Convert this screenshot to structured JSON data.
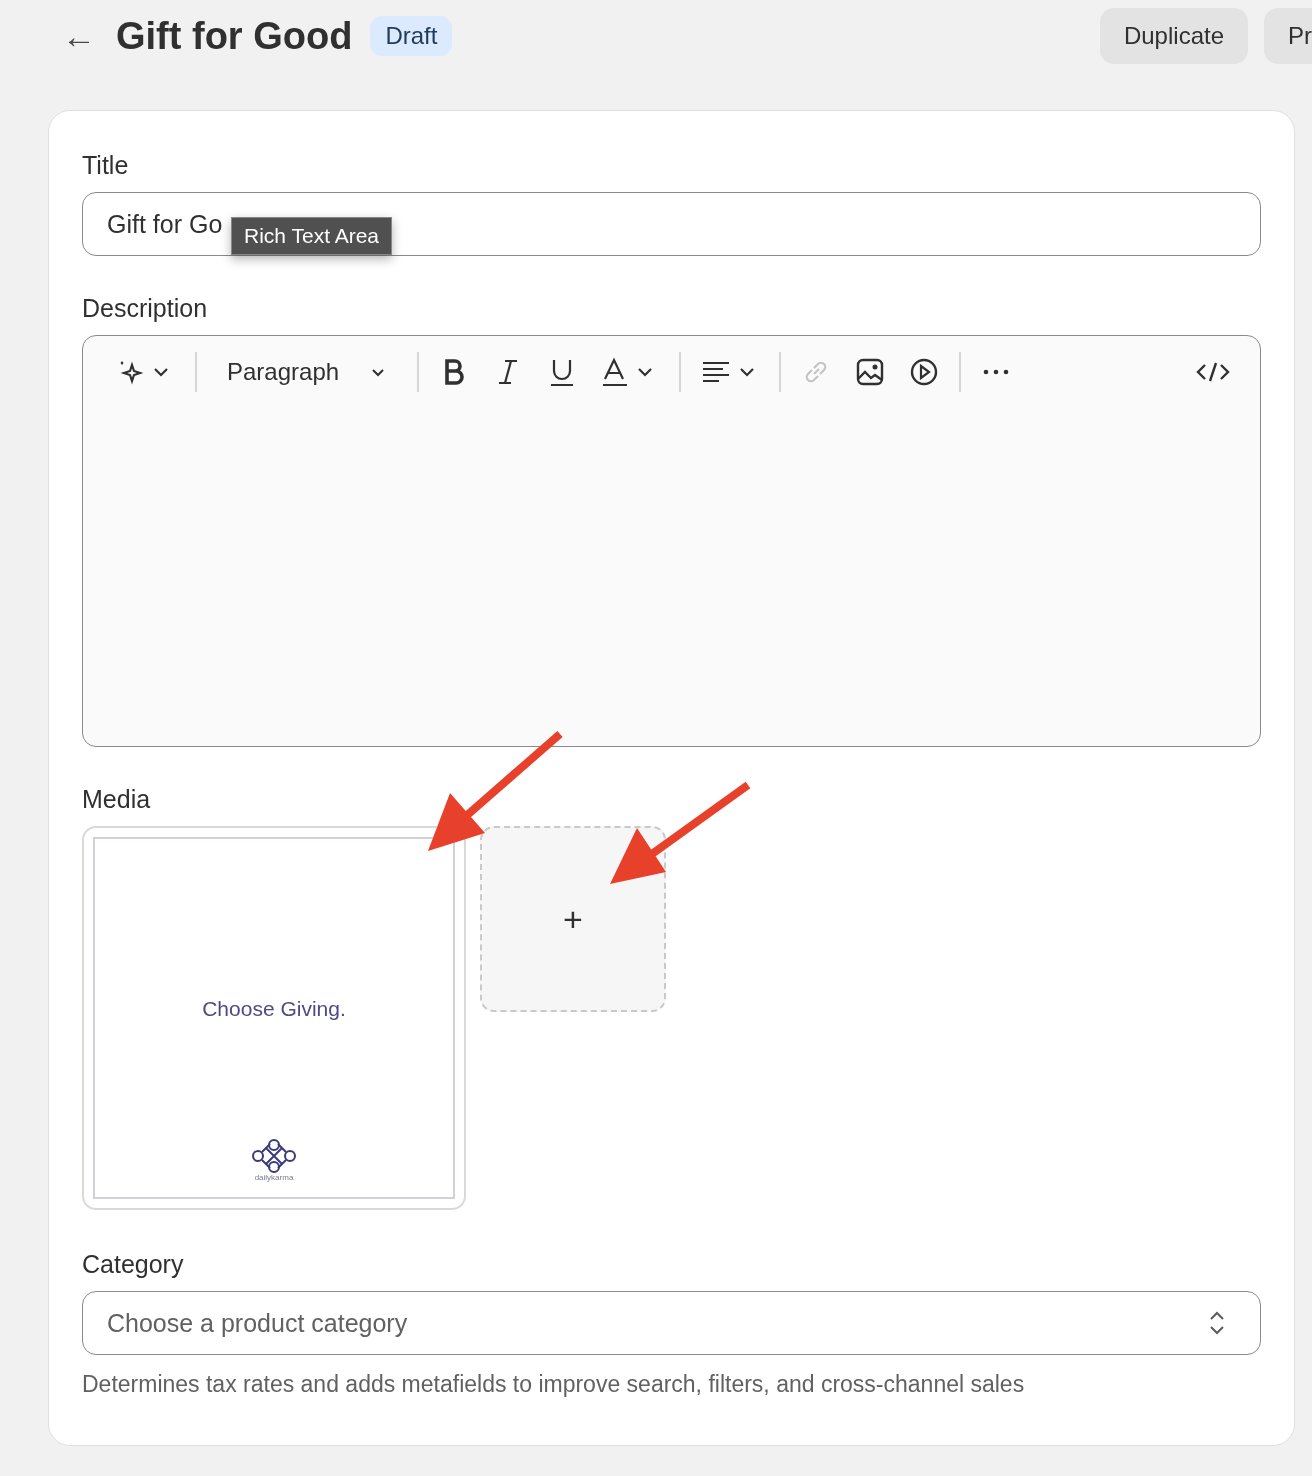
{
  "header": {
    "back": "←",
    "title": "Gift for Good",
    "status": "Draft",
    "buttons": [
      "Duplicate",
      "Pr"
    ]
  },
  "title_field": {
    "label": "Title",
    "value": "Gift for Go",
    "tooltip": "Rich Text Area"
  },
  "description": {
    "label": "Description",
    "toolbar": [
      {
        "kind": "ai",
        "disabled": false
      },
      {
        "kind": "divider"
      },
      {
        "kind": "format",
        "label": "Paragraph",
        "disabled": false
      },
      {
        "kind": "divider"
      },
      {
        "kind": "bold",
        "disabled": false
      },
      {
        "kind": "italic",
        "disabled": false
      },
      {
        "kind": "underline",
        "disabled": false
      },
      {
        "kind": "color",
        "disabled": false
      },
      {
        "kind": "divider"
      },
      {
        "kind": "align",
        "disabled": false
      },
      {
        "kind": "divider"
      },
      {
        "kind": "link",
        "disabled": true
      },
      {
        "kind": "image",
        "disabled": false
      },
      {
        "kind": "video",
        "disabled": false
      },
      {
        "kind": "divider"
      },
      {
        "kind": "more",
        "disabled": false
      },
      {
        "kind": "code",
        "disabled": false
      }
    ]
  },
  "media": {
    "label": "Media",
    "items": [
      {
        "kind": "image",
        "caption": "Choose Giving.",
        "brand": "dailykarma"
      },
      {
        "kind": "add",
        "label": "+"
      }
    ]
  },
  "category": {
    "label": "Category",
    "placeholder": "Choose a product category",
    "help": "Determines tax rates and adds metafields to improve search, filters, and cross-channel sales"
  }
}
